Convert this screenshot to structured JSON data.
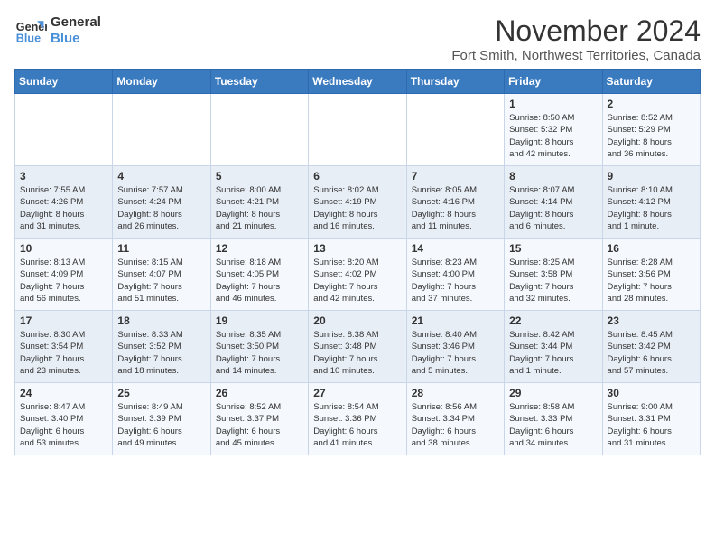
{
  "logo": {
    "line1": "General",
    "line2": "Blue"
  },
  "title": "November 2024",
  "subtitle": "Fort Smith, Northwest Territories, Canada",
  "weekdays": [
    "Sunday",
    "Monday",
    "Tuesday",
    "Wednesday",
    "Thursday",
    "Friday",
    "Saturday"
  ],
  "weeks": [
    [
      {
        "day": "",
        "info": ""
      },
      {
        "day": "",
        "info": ""
      },
      {
        "day": "",
        "info": ""
      },
      {
        "day": "",
        "info": ""
      },
      {
        "day": "",
        "info": ""
      },
      {
        "day": "1",
        "info": "Sunrise: 8:50 AM\nSunset: 5:32 PM\nDaylight: 8 hours\nand 42 minutes."
      },
      {
        "day": "2",
        "info": "Sunrise: 8:52 AM\nSunset: 5:29 PM\nDaylight: 8 hours\nand 36 minutes."
      }
    ],
    [
      {
        "day": "3",
        "info": "Sunrise: 7:55 AM\nSunset: 4:26 PM\nDaylight: 8 hours\nand 31 minutes."
      },
      {
        "day": "4",
        "info": "Sunrise: 7:57 AM\nSunset: 4:24 PM\nDaylight: 8 hours\nand 26 minutes."
      },
      {
        "day": "5",
        "info": "Sunrise: 8:00 AM\nSunset: 4:21 PM\nDaylight: 8 hours\nand 21 minutes."
      },
      {
        "day": "6",
        "info": "Sunrise: 8:02 AM\nSunset: 4:19 PM\nDaylight: 8 hours\nand 16 minutes."
      },
      {
        "day": "7",
        "info": "Sunrise: 8:05 AM\nSunset: 4:16 PM\nDaylight: 8 hours\nand 11 minutes."
      },
      {
        "day": "8",
        "info": "Sunrise: 8:07 AM\nSunset: 4:14 PM\nDaylight: 8 hours\nand 6 minutes."
      },
      {
        "day": "9",
        "info": "Sunrise: 8:10 AM\nSunset: 4:12 PM\nDaylight: 8 hours\nand 1 minute."
      }
    ],
    [
      {
        "day": "10",
        "info": "Sunrise: 8:13 AM\nSunset: 4:09 PM\nDaylight: 7 hours\nand 56 minutes."
      },
      {
        "day": "11",
        "info": "Sunrise: 8:15 AM\nSunset: 4:07 PM\nDaylight: 7 hours\nand 51 minutes."
      },
      {
        "day": "12",
        "info": "Sunrise: 8:18 AM\nSunset: 4:05 PM\nDaylight: 7 hours\nand 46 minutes."
      },
      {
        "day": "13",
        "info": "Sunrise: 8:20 AM\nSunset: 4:02 PM\nDaylight: 7 hours\nand 42 minutes."
      },
      {
        "day": "14",
        "info": "Sunrise: 8:23 AM\nSunset: 4:00 PM\nDaylight: 7 hours\nand 37 minutes."
      },
      {
        "day": "15",
        "info": "Sunrise: 8:25 AM\nSunset: 3:58 PM\nDaylight: 7 hours\nand 32 minutes."
      },
      {
        "day": "16",
        "info": "Sunrise: 8:28 AM\nSunset: 3:56 PM\nDaylight: 7 hours\nand 28 minutes."
      }
    ],
    [
      {
        "day": "17",
        "info": "Sunrise: 8:30 AM\nSunset: 3:54 PM\nDaylight: 7 hours\nand 23 minutes."
      },
      {
        "day": "18",
        "info": "Sunrise: 8:33 AM\nSunset: 3:52 PM\nDaylight: 7 hours\nand 18 minutes."
      },
      {
        "day": "19",
        "info": "Sunrise: 8:35 AM\nSunset: 3:50 PM\nDaylight: 7 hours\nand 14 minutes."
      },
      {
        "day": "20",
        "info": "Sunrise: 8:38 AM\nSunset: 3:48 PM\nDaylight: 7 hours\nand 10 minutes."
      },
      {
        "day": "21",
        "info": "Sunrise: 8:40 AM\nSunset: 3:46 PM\nDaylight: 7 hours\nand 5 minutes."
      },
      {
        "day": "22",
        "info": "Sunrise: 8:42 AM\nSunset: 3:44 PM\nDaylight: 7 hours\nand 1 minute."
      },
      {
        "day": "23",
        "info": "Sunrise: 8:45 AM\nSunset: 3:42 PM\nDaylight: 6 hours\nand 57 minutes."
      }
    ],
    [
      {
        "day": "24",
        "info": "Sunrise: 8:47 AM\nSunset: 3:40 PM\nDaylight: 6 hours\nand 53 minutes."
      },
      {
        "day": "25",
        "info": "Sunrise: 8:49 AM\nSunset: 3:39 PM\nDaylight: 6 hours\nand 49 minutes."
      },
      {
        "day": "26",
        "info": "Sunrise: 8:52 AM\nSunset: 3:37 PM\nDaylight: 6 hours\nand 45 minutes."
      },
      {
        "day": "27",
        "info": "Sunrise: 8:54 AM\nSunset: 3:36 PM\nDaylight: 6 hours\nand 41 minutes."
      },
      {
        "day": "28",
        "info": "Sunrise: 8:56 AM\nSunset: 3:34 PM\nDaylight: 6 hours\nand 38 minutes."
      },
      {
        "day": "29",
        "info": "Sunrise: 8:58 AM\nSunset: 3:33 PM\nDaylight: 6 hours\nand 34 minutes."
      },
      {
        "day": "30",
        "info": "Sunrise: 9:00 AM\nSunset: 3:31 PM\nDaylight: 6 hours\nand 31 minutes."
      }
    ]
  ]
}
